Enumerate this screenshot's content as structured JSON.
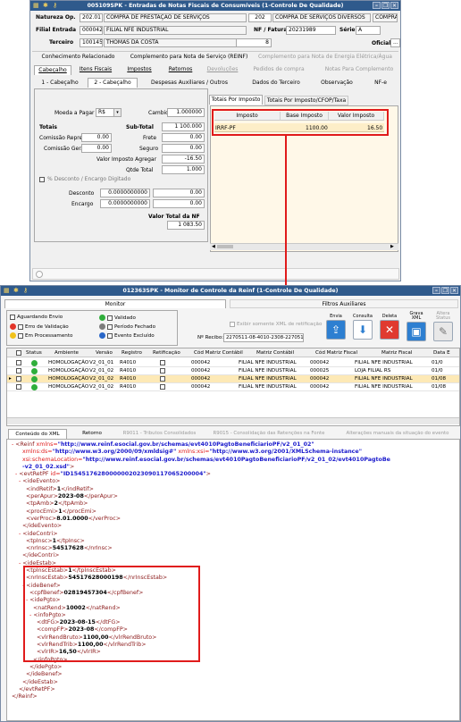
{
  "win1": {
    "title": "005109SPK - Entradas de Notas Fiscais de Consumíveis (1-Controle De Qualidade)",
    "natureza_label": "Natureza Op.",
    "natureza_code": "202.01",
    "natureza_desc": "COMPRA DE PRESTAÇÃO DE SERVIÇOS",
    "natureza_num": "202",
    "natureza_desc2": "COMPRA DE SERVIÇOS DIVERSOS",
    "natureza_tipo": "COMPRAS",
    "filial_label": "Filial Entrada",
    "filial_code": "000042",
    "filial_desc": "FILIAL NFE INDUSTRIAL",
    "nf_label": "NF / Fatura",
    "nf_value": "20231989",
    "serie_label": "Série",
    "serie_value": "A",
    "terceiro_label": "Terceiro",
    "terceiro_code": "100145",
    "terceiro_desc": "THOMAS DA COSTA",
    "terceiro_num": "8",
    "oficial_label": "Oficial",
    "oficial_btn": "...",
    "top_tabs": [
      "Conhecimento Relacionado",
      "Complemento para Nota de Serviço (REINF)",
      "Complemento para Nota de Energia Elétrica/Água"
    ],
    "tabs": [
      "Cabeçalho",
      "Itens Fiscais",
      "Impostos",
      "Retornos",
      "Devoluções",
      "Pedidos de compra",
      "Notas Para Complemento"
    ],
    "subtabs": [
      "1 - Cabeçalho",
      "2 - Cabeçalho",
      "Despesas Auxiliares / Outros",
      "Dados do Terceiro",
      "Observação",
      "NF-e"
    ],
    "moeda_label": "Moeda a Pagar",
    "moeda_value": "R$",
    "cambio_label": "Cambio",
    "cambio_value": "1.000000",
    "totais_label": "Totais",
    "subtotal_label": "Sub-Total",
    "subtotal_value": "1 100.000",
    "comissao_repre_label": "Comissão Repre.",
    "comissao_repre_value": "0.00",
    "frete_label": "Frete",
    "frete_value": "0.00",
    "comissao_ger_label": "Comissão Ger.",
    "comissao_ger_value": "0.00",
    "seguro_label": "Seguro",
    "seguro_value": "0.00",
    "valor_imp_label": "Valor Imposto Agregar",
    "valor_imp_value": "-16.50",
    "qtde_label": "Qtde Total",
    "qtde_value": "1.000",
    "perc_desc_label": "% Desconto / Encargo Digitado",
    "desconto_label": "Desconto",
    "desconto_pct": "0.0000000000",
    "desconto_value": "0.00",
    "encargo_label": "Encargo",
    "encargo_pct": "0.0000000000",
    "encargo_value": "0.00",
    "valor_total_label": "Valor Total da NF",
    "valor_total_value": "1 083.50",
    "imp_tabs": [
      "Totais Por Imposto",
      "Totais Por Imposto/CFOP/Taxa"
    ],
    "imp_headers": [
      "Imposto",
      "Base Imposto",
      "Valor Imposto"
    ],
    "imp_row": {
      "imposto": "IRRF-PF",
      "base": "1100.00",
      "valor": "16.50"
    }
  },
  "win2": {
    "title": "012363SPK - Monitor de Controle da Reinf (1-Controle De Qualidade)",
    "tabs": [
      "Monitor",
      "Filtros Auxiliares"
    ],
    "legend": [
      "Aguardando Envio",
      "Erro de Validação",
      "Em Processamento",
      "Validado",
      "Período Fechado",
      "Evento Excluído"
    ],
    "xml_check": "Exibir somente XML de retificação",
    "recibo_label": "Nº Recibo:",
    "recibo_value": "2270511-08-4010-2308-2270511",
    "toolbar": [
      "Envia",
      "Consulta",
      "Deleta",
      "Grava XML",
      "Altera Status"
    ],
    "grid_headers": [
      "Status",
      "Ambiente",
      "Versão",
      "Registro",
      "Retificação",
      "Cód Matriz Contábil",
      "Matriz Contábil",
      "Cód Matriz Fiscal",
      "Matriz Fiscal",
      "Data E"
    ],
    "rows": [
      {
        "amb": "HOMOLOGAÇÃO",
        "ver": "V2_01_01",
        "reg": "R4010",
        "cmc": "000042",
        "mc": "FILIAL NFE INDUSTRIAL",
        "cmf": "000042",
        "mf": "FILIAL NFE INDUSTRIAL",
        "dt": "01/0"
      },
      {
        "amb": "HOMOLOGAÇÃO",
        "ver": "V2_01_02",
        "reg": "R4010",
        "cmc": "000042",
        "mc": "FILIAL NFE INDUSTRIAL",
        "cmf": "000025",
        "mf": "LOJA FILIAL RS",
        "dt": "01/0"
      },
      {
        "amb": "HOMOLOGAÇÃO",
        "ver": "V2_01_02",
        "reg": "R4010",
        "cmc": "000042",
        "mc": "FILIAL NFE INDUSTRIAL",
        "cmf": "000042",
        "mf": "FILIAL NFE INDUSTRIAL",
        "dt": "01/08"
      },
      {
        "amb": "HOMOLOGAÇÃO",
        "ver": "V2_01_02",
        "reg": "R4010",
        "cmc": "000042",
        "mc": "FILIAL NFE INDUSTRIAL",
        "cmf": "000042",
        "mf": "FILIAL NFE INDUSTRIAL",
        "dt": "01/08"
      }
    ],
    "bottom_tabs": [
      "Conteúdo do XML",
      "Retorno",
      "R9011 - Tributos Consolidados",
      "R9015 - Consolidação das Retenções na Fonte",
      "Alterações manuais da situação do evento"
    ],
    "xml": {
      "reinf_ns": "http://www.reinf.esocial.gov.br/schemas/evt4010PagtoBeneficiarioPF/v2_01_02",
      "ds_ns": "http://www.w3.org/2000/09/xmldsig#",
      "xsi_ns": "http://www.w3.org/2001/XMLSchema-instance",
      "schema_loc": "http://www.reinf.esocial.gov.br/schemas/evt4010PagtoBeneficiarioPF/v2_01_02/evt4010PagtoBe",
      "schema_loc2": "-v2_01_02.xsd",
      "evt_id": "ID1545176280000002023090117065200004",
      "indRetif": "1",
      "perApur": "2023-08",
      "tpAmb": "2",
      "procEmi": "1",
      "verProc": "8.01.0000",
      "tpInsc": "1",
      "nrInsc": "54517628",
      "tpInscEstab": "1",
      "nrInscEstab": "54517628000198",
      "cpfBenef": "02819457304",
      "natRend": "10002",
      "dtFG": "2023-08-15",
      "compFP": "2023-08",
      "vlrRendBruto": "1100,00",
      "vlrRendTrib": "1100,00",
      "vlrIR": "16,50"
    }
  }
}
